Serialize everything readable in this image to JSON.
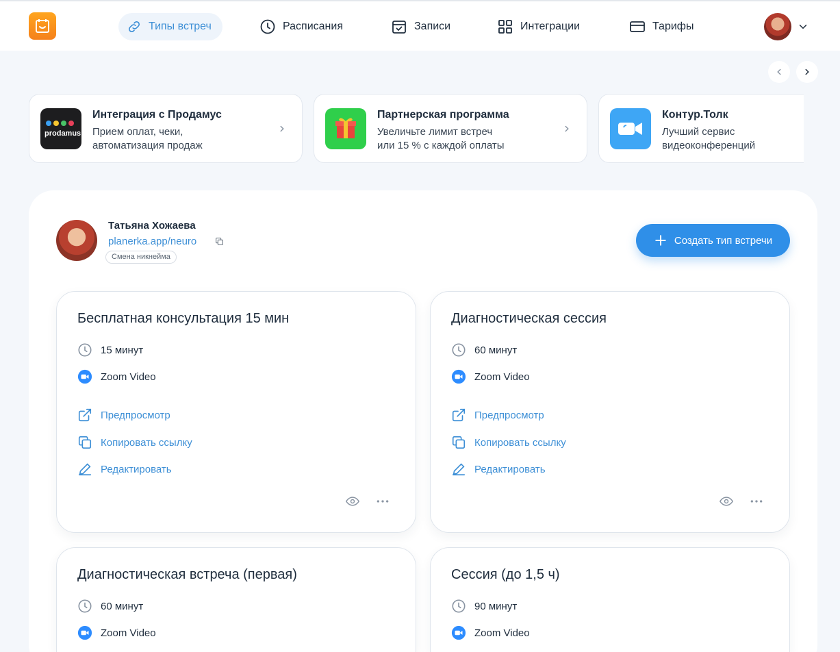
{
  "header": {
    "nav": [
      {
        "label": "Типы встреч",
        "icon": "link-icon",
        "active": true
      },
      {
        "label": "Расписания",
        "icon": "clock-icon"
      },
      {
        "label": "Записи",
        "icon": "calendar-check-icon"
      },
      {
        "label": "Интеграции",
        "icon": "grid-icon"
      },
      {
        "label": "Тарифы",
        "icon": "card-icon"
      }
    ]
  },
  "promos": [
    {
      "title": "Интеграция с Продамус",
      "desc_line1": "Прием оплат, чеки,",
      "desc_line2": "автоматизация продаж",
      "logo_text": "prodamus"
    },
    {
      "title": "Партнерская программа",
      "desc_line1": "Увеличьте лимит встреч",
      "desc_line2": "или 15 % с каждой оплаты"
    },
    {
      "title": "Контур.Толк",
      "desc_line1": "Лучший сервис",
      "desc_line2": "видеоконференций"
    }
  ],
  "profile": {
    "name": "Татьяна Хожаева",
    "link": "planerka.app/neuro",
    "nick_badge": "Смена никнейма"
  },
  "create_button": "Создать тип встречи",
  "event_actions": {
    "preview": "Предпросмотр",
    "copy": "Копировать ссылку",
    "edit": "Редактировать"
  },
  "events": [
    {
      "title": "Бесплатная консультация 15 мин",
      "duration": "15 минут",
      "location": "Zoom Video"
    },
    {
      "title": "Диагностическая сессия",
      "duration": "60 минут",
      "location": "Zoom Video"
    },
    {
      "title": "Диагностическая встреча (первая)",
      "duration": "60 минут",
      "location": "Zoom Video"
    },
    {
      "title": "Сессия (до 1,5 ч)",
      "duration": "90 минут",
      "location": "Zoom Video"
    }
  ],
  "colors": {
    "accent": "#2f8fe8",
    "link": "#3d8fd6",
    "brand_orange": "#f5811b"
  }
}
